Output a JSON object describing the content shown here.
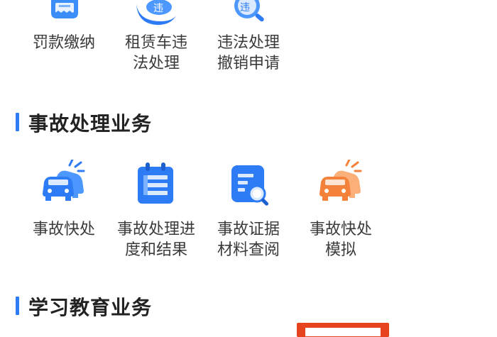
{
  "top_row": [
    {
      "label": "罚款缴纳",
      "icon": "fine-receipt-icon"
    },
    {
      "label": "租赁车违\n法处理",
      "icon": "rental-car-violation-icon"
    },
    {
      "label": "违法处理\n撤销申请",
      "icon": "violation-search-icon"
    }
  ],
  "sections": {
    "accident": {
      "title": "事故处理业务",
      "items": [
        {
          "label": "事故快处",
          "icon": "car-crash-icon"
        },
        {
          "label": "事故处理进\n度和结果",
          "icon": "calendar-list-icon"
        },
        {
          "label": "事故证据\n材料查阅",
          "icon": "document-search-icon"
        },
        {
          "label": "事故快处\n模拟",
          "icon": "car-crash-orange-icon"
        }
      ]
    },
    "education": {
      "title": "学习教育业务"
    }
  },
  "colors": {
    "accent_blue": "#2d7cf6",
    "icon_blue_light": "#63a9ff",
    "icon_orange": "#f5823a",
    "highlight_red": "#e8431f"
  }
}
